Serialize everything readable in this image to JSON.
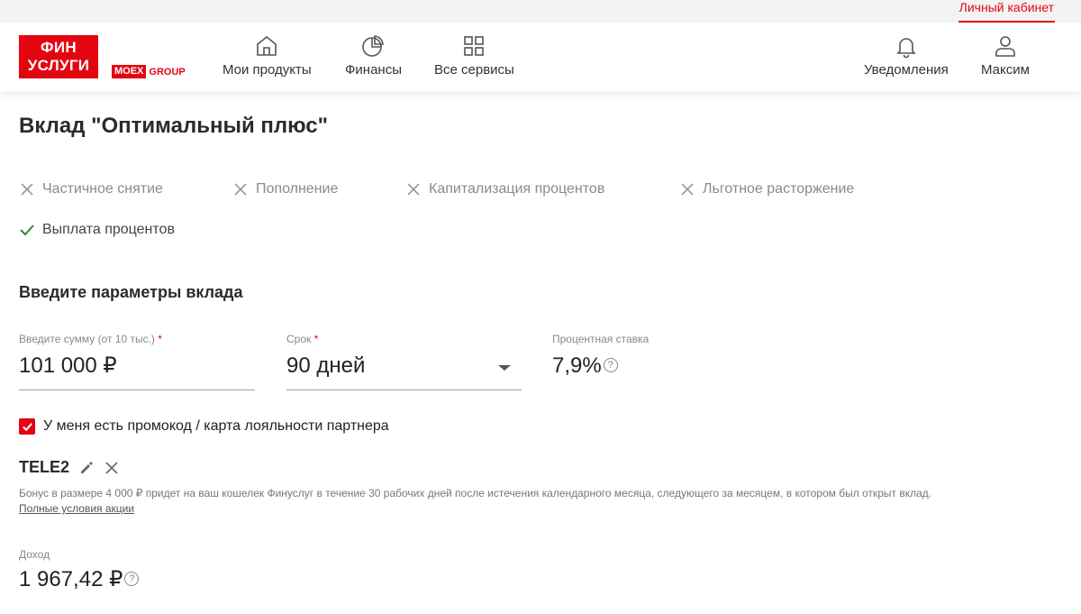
{
  "topbar": {
    "cabinet_label": "Личный кабинет"
  },
  "brand": {
    "line1": "ФИН",
    "line2": "УСЛУГИ",
    "moex_box": "MOEX",
    "moex_group": "GROUP"
  },
  "nav": {
    "products": "Мои продукты",
    "finance": "Финансы",
    "services": "Все сервисы",
    "notifications": "Уведомления",
    "user": "Максим"
  },
  "page": {
    "title": "Вклад \"Оптимальный плюс\""
  },
  "features": [
    {
      "label": "Частичное снятие",
      "enabled": false
    },
    {
      "label": "Пополнение",
      "enabled": false
    },
    {
      "label": "Капитализация процентов",
      "enabled": false
    },
    {
      "label": "Льготное расторжение",
      "enabled": false
    },
    {
      "label": "Выплата процентов",
      "enabled": true
    }
  ],
  "params": {
    "section_title": "Введите параметры вклада",
    "amount": {
      "label": "Введите сумму (от 10 тыс.)",
      "required_mark": "*",
      "value": "101 000 ₽"
    },
    "term": {
      "label": "Срок",
      "required_mark": "*",
      "value": "90 дней"
    },
    "rate": {
      "label": "Процентная ставка",
      "value": "7,9%",
      "help": "?"
    }
  },
  "promo": {
    "checkbox_label": "У меня есть промокод / карта лояльности партнера",
    "checked": true,
    "code": "TELE2",
    "bonus_text": "Бонус в размере 4 000 ₽ придет на ваш кошелек Финуслуг в течение 30 рабочих дней после истечения календарного месяца, следующего за месяцем, в котором был открыт вклад.",
    "terms_link": "Полные условия акции"
  },
  "income": {
    "label": "Доход",
    "value": "1 967,42 ₽",
    "help": "?"
  },
  "colors": {
    "accent": "#e30611",
    "check_green": "#2e8b3a"
  }
}
